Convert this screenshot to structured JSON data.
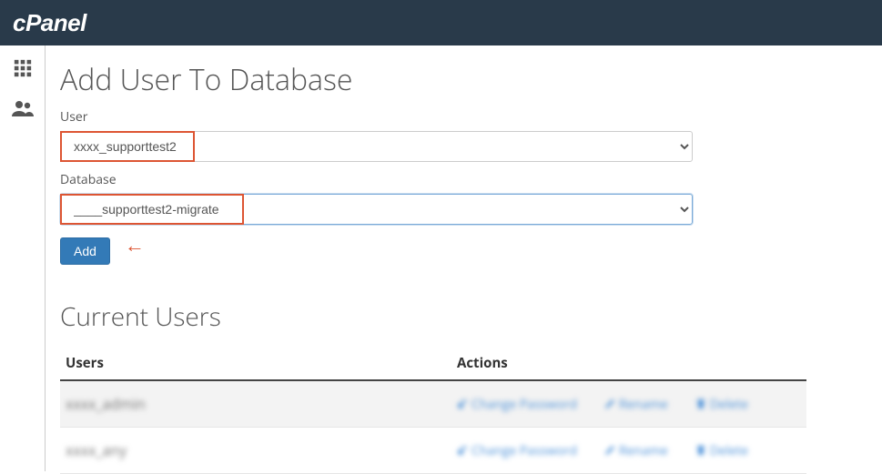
{
  "header": {
    "brand": "cPanel"
  },
  "page": {
    "title": "Add User To Database",
    "user_label": "User",
    "user_value": "xxxx_supporttest2",
    "database_label": "Database",
    "database_value": "____supporttest2-migrate",
    "add_button": "Add"
  },
  "section": {
    "current_users_title": "Current Users",
    "col_users": "Users",
    "col_actions": "Actions"
  },
  "rows": [
    {
      "user": "xxxx_admin",
      "change_pw": "Change Password",
      "rename": "Rename",
      "delete": "Delete"
    },
    {
      "user": "xxxx_any",
      "change_pw": "Change Password",
      "rename": "Rename",
      "delete": "Delete"
    }
  ]
}
